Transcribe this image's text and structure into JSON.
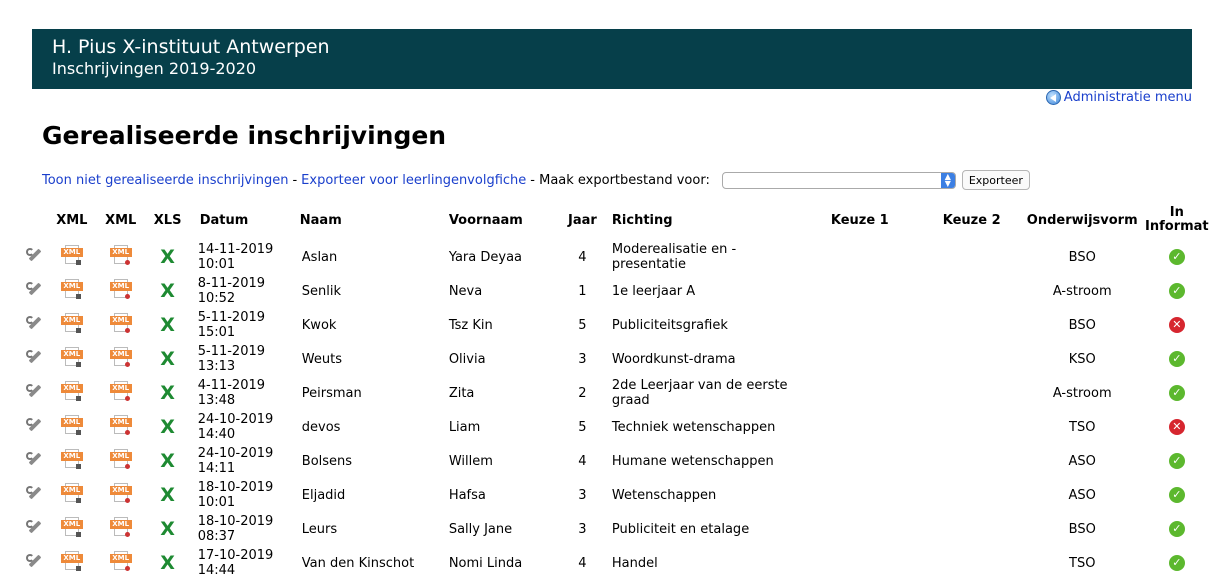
{
  "header": {
    "school": "H. Pius X-instituut Antwerpen",
    "subtitle": "Inschrijvingen 2019-2020"
  },
  "admin_menu": "Administratie menu",
  "page_title": "Gerealiseerde inschrijvingen",
  "actions": {
    "link_niet_gerealiseerd": "Toon niet gerealiseerde inschrijvingen",
    "separator": "-",
    "link_exporteer_llv": "Exporteer voor leerlingenvolgfiche",
    "export_label": "- Maak exportbestand voor:",
    "export_select_value": "",
    "export_button": "Exporteer"
  },
  "table": {
    "headers": {
      "xml1": "XML",
      "xml2": "XML",
      "xls": "XLS",
      "datum": "Datum",
      "naam": "Naam",
      "voornaam": "Voornaam",
      "jaar": "Jaar",
      "richting": "Richting",
      "keuze1": "Keuze 1",
      "keuze2": "Keuze 2",
      "onderwijsvorm": "Onderwijsvorm",
      "informat": "In Informat"
    },
    "rows": [
      {
        "date": "14-11-2019 10:01",
        "naam": "Aslan",
        "voornaam": "Yara Deyaa",
        "jaar": "4",
        "richting": "Moderealisatie en -presentatie",
        "keuze1": "",
        "keuze2": "",
        "vorm": "BSO",
        "informat": "yes",
        "informat_symbol": "✓"
      },
      {
        "date": "8-11-2019 10:52",
        "naam": "Senlik",
        "voornaam": "Neva",
        "jaar": "1",
        "richting": "1e leerjaar A",
        "keuze1": "",
        "keuze2": "",
        "vorm": "A-stroom",
        "informat": "yes",
        "informat_symbol": "✓"
      },
      {
        "date": "5-11-2019 15:01",
        "naam": "Kwok",
        "voornaam": "Tsz Kin",
        "jaar": "5",
        "richting": "Publiciteitsgrafiek",
        "keuze1": "",
        "keuze2": "",
        "vorm": "BSO",
        "informat": "no",
        "informat_symbol": "✕"
      },
      {
        "date": "5-11-2019 13:13",
        "naam": "Weuts",
        "voornaam": "Olivia",
        "jaar": "3",
        "richting": "Woordkunst-drama",
        "keuze1": "",
        "keuze2": "",
        "vorm": "KSO",
        "informat": "yes",
        "informat_symbol": "✓"
      },
      {
        "date": "4-11-2019 13:48",
        "naam": "Peirsman",
        "voornaam": "Zita",
        "jaar": "2",
        "richting": "2de Leerjaar van de eerste graad",
        "keuze1": "",
        "keuze2": "",
        "vorm": "A-stroom",
        "informat": "yes",
        "informat_symbol": "✓"
      },
      {
        "date": "24-10-2019 14:40",
        "naam": "devos",
        "voornaam": "Liam",
        "jaar": "5",
        "richting": "Techniek wetenschappen",
        "keuze1": "",
        "keuze2": "",
        "vorm": "TSO",
        "informat": "no",
        "informat_symbol": "✕"
      },
      {
        "date": "24-10-2019 14:11",
        "naam": "Bolsens",
        "voornaam": "Willem",
        "jaar": "4",
        "richting": "Humane wetenschappen",
        "keuze1": "",
        "keuze2": "",
        "vorm": "ASO",
        "informat": "yes",
        "informat_symbol": "✓"
      },
      {
        "date": "18-10-2019 10:01",
        "naam": "Eljadid",
        "voornaam": "Hafsa",
        "jaar": "3",
        "richting": "Wetenschappen",
        "keuze1": "",
        "keuze2": "",
        "vorm": "ASO",
        "informat": "yes",
        "informat_symbol": "✓"
      },
      {
        "date": "18-10-2019 08:37",
        "naam": "Leurs",
        "voornaam": "Sally Jane",
        "jaar": "3",
        "richting": "Publiciteit en etalage",
        "keuze1": "",
        "keuze2": "",
        "vorm": "BSO",
        "informat": "yes",
        "informat_symbol": "✓"
      },
      {
        "date": "17-10-2019 14:44",
        "naam": "Van den Kinschot",
        "voornaam": "Nomi Linda",
        "jaar": "4",
        "richting": "Handel",
        "keuze1": "",
        "keuze2": "",
        "vorm": "TSO",
        "informat": "yes",
        "informat_symbol": "✓"
      }
    ],
    "icons": {
      "edit": "wrench-icon",
      "xml": "xml-file-icon",
      "xls": "excel-icon",
      "yes": "check-circle-icon",
      "no": "cross-circle-icon"
    },
    "xml_badge": "XML",
    "xls_glyph": "X"
  },
  "colors": {
    "banner": "#063f4a",
    "link": "#1a3fcc",
    "ok": "#5cb82e",
    "no": "#d6262f"
  }
}
